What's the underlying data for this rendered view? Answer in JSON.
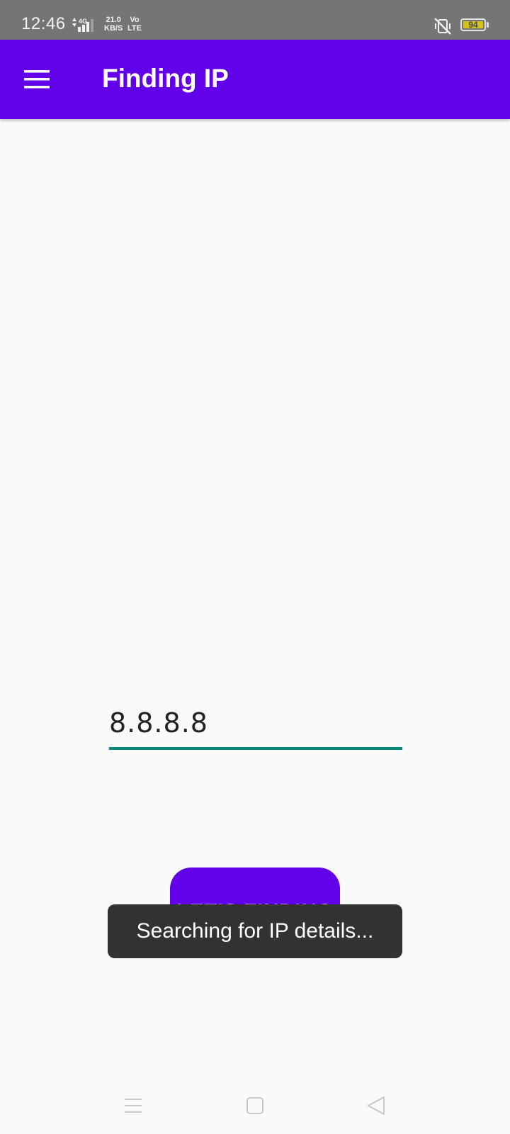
{
  "status_bar": {
    "time": "12:46",
    "network_type": "4G",
    "net_speed_value": "21.0",
    "net_speed_unit": "KB/S",
    "volte_top": "Vo",
    "volte_bottom": "LTE",
    "battery_level": "94",
    "icons": [
      "signal-icon",
      "mute-icon",
      "battery-icon"
    ]
  },
  "app_bar": {
    "title": "Finding IP",
    "menu_icon": "hamburger-menu-icon",
    "background": "#6200ea"
  },
  "form": {
    "ip_value": "8.8.8.8",
    "underline_color": "#00897b"
  },
  "button": {
    "label": "LET'S FINDING"
  },
  "toast": {
    "message": "Searching for IP details..."
  },
  "nav_bar": {
    "icons": [
      "recent-apps-icon",
      "home-icon",
      "back-icon"
    ]
  }
}
